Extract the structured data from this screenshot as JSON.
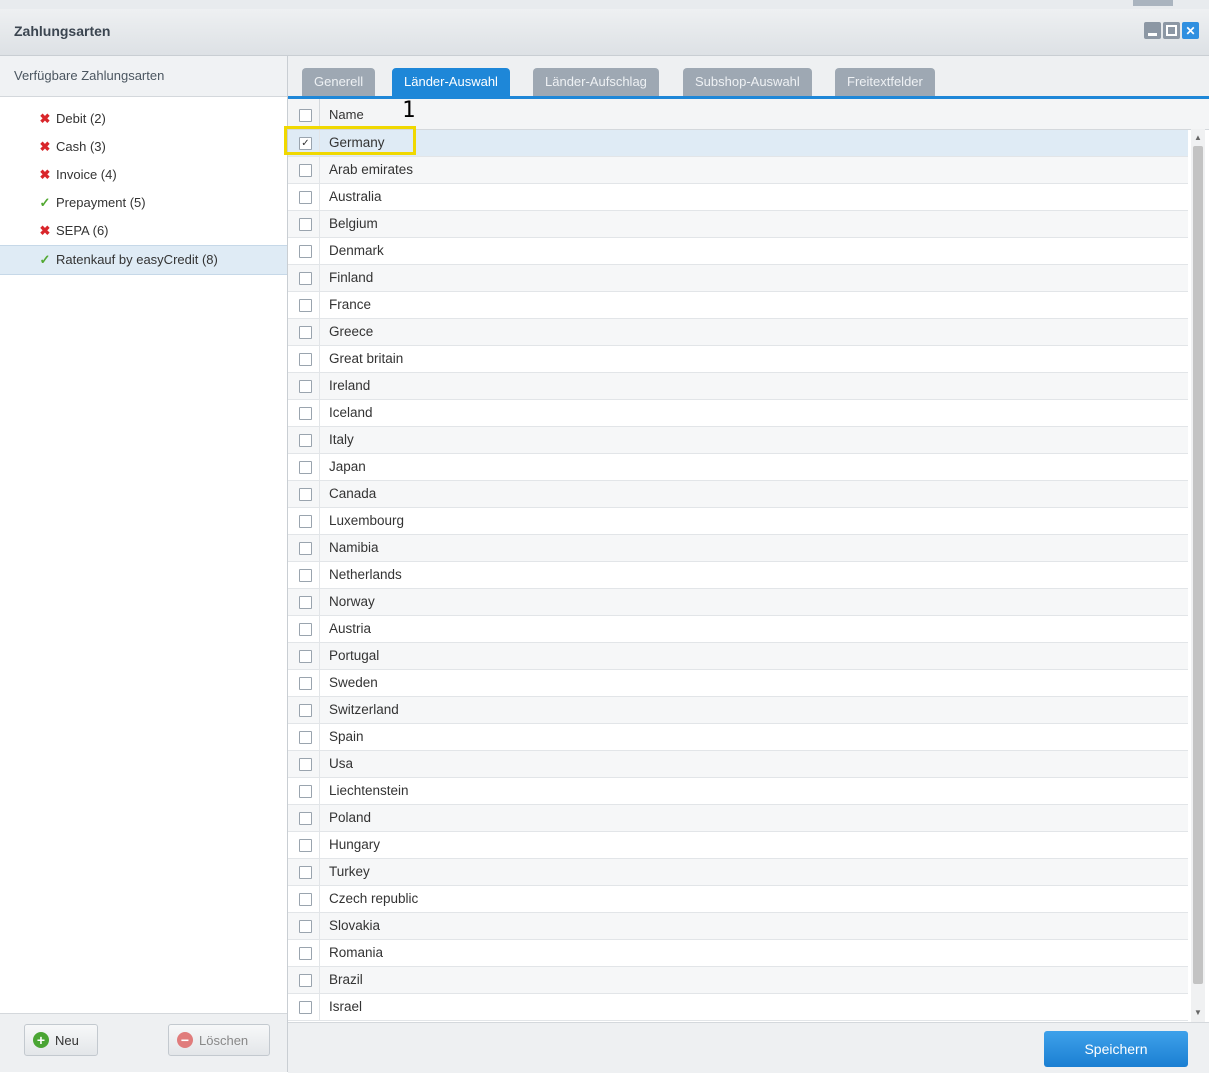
{
  "window": {
    "title": "Zahlungsarten",
    "controls": [
      "minimize",
      "maximize",
      "close"
    ]
  },
  "sidebar": {
    "header": "Verfügbare Zahlungsarten",
    "items": [
      {
        "label": "Debit (2)",
        "status": "inactive"
      },
      {
        "label": "Cash (3)",
        "status": "inactive"
      },
      {
        "label": "Invoice (4)",
        "status": "inactive"
      },
      {
        "label": "Prepayment (5)",
        "status": "active"
      },
      {
        "label": "SEPA (6)",
        "status": "inactive"
      },
      {
        "label": "Ratenkauf by easyCredit (8)",
        "status": "active",
        "selected": true
      }
    ],
    "buttons": {
      "new": "Neu",
      "delete": "Löschen"
    }
  },
  "tabs": [
    {
      "label": "Generell",
      "active": false
    },
    {
      "label": "Länder-Auswahl",
      "active": true
    },
    {
      "label": "Länder-Aufschlag",
      "active": false
    },
    {
      "label": "Subshop-Auswahl",
      "active": false
    },
    {
      "label": "Freitextfelder",
      "active": false
    }
  ],
  "grid": {
    "column": "Name",
    "rows": [
      {
        "name": "Germany",
        "checked": true
      },
      {
        "name": "Arab emirates",
        "checked": false
      },
      {
        "name": "Australia",
        "checked": false
      },
      {
        "name": "Belgium",
        "checked": false
      },
      {
        "name": "Denmark",
        "checked": false
      },
      {
        "name": "Finland",
        "checked": false
      },
      {
        "name": "France",
        "checked": false
      },
      {
        "name": "Greece",
        "checked": false
      },
      {
        "name": "Great britain",
        "checked": false
      },
      {
        "name": "Ireland",
        "checked": false
      },
      {
        "name": "Iceland",
        "checked": false
      },
      {
        "name": "Italy",
        "checked": false
      },
      {
        "name": "Japan",
        "checked": false
      },
      {
        "name": "Canada",
        "checked": false
      },
      {
        "name": "Luxembourg",
        "checked": false
      },
      {
        "name": "Namibia",
        "checked": false
      },
      {
        "name": "Netherlands",
        "checked": false
      },
      {
        "name": "Norway",
        "checked": false
      },
      {
        "name": "Austria",
        "checked": false
      },
      {
        "name": "Portugal",
        "checked": false
      },
      {
        "name": "Sweden",
        "checked": false
      },
      {
        "name": "Switzerland",
        "checked": false
      },
      {
        "name": "Spain",
        "checked": false
      },
      {
        "name": "Usa",
        "checked": false
      },
      {
        "name": "Liechtenstein",
        "checked": false
      },
      {
        "name": "Poland",
        "checked": false
      },
      {
        "name": "Hungary",
        "checked": false
      },
      {
        "name": "Turkey",
        "checked": false
      },
      {
        "name": "Czech republic",
        "checked": false
      },
      {
        "name": "Slovakia",
        "checked": false
      },
      {
        "name": "Romania",
        "checked": false
      },
      {
        "name": "Brazil",
        "checked": false
      },
      {
        "name": "Israel",
        "checked": false
      }
    ]
  },
  "annotation": {
    "number": "1"
  },
  "footer": {
    "save": "Speichern"
  },
  "colors": {
    "accent": "#1e87d8",
    "highlight": "#f0d800",
    "ok": "#52a832",
    "error": "#d9262b"
  }
}
